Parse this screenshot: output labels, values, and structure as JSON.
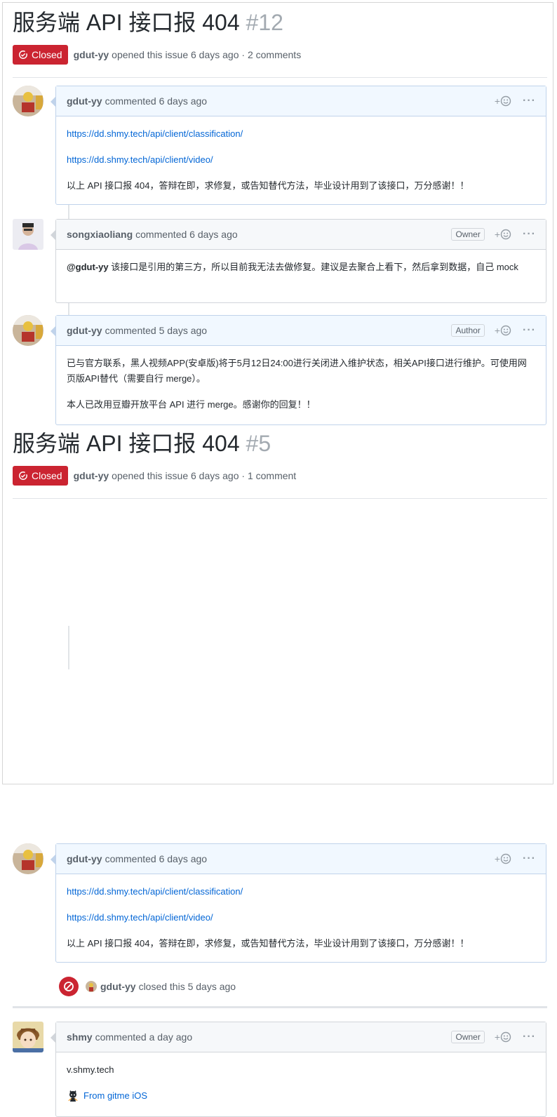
{
  "issues": [
    {
      "title": "服务端 API 接口报 404",
      "number": "#12",
      "state": "Closed",
      "opener": "gdut-yy",
      "opened_text": "opened this issue 6 days ago · 2 comments",
      "comments": [
        {
          "author": "gdut-yy",
          "time": "commented 6 days ago",
          "links": [
            "https://dd.shmy.tech/api/client/classification/",
            "https://dd.shmy.tech/api/client/video/"
          ],
          "text": "以上 API 接口报 404，答辩在即，求修复，或告知替代方法，毕业设计用到了该接口，万分感谢！！"
        },
        {
          "author": "songxiaoliang",
          "time": "commented 6 days ago",
          "role": "Owner",
          "mention": "@gdut-yy",
          "text": " 该接口是引用的第三方，所以目前我无法去做修复。建议是去聚合上看下，然后拿到数据，自己 mock"
        },
        {
          "author": "gdut-yy",
          "time": "commented 5 days ago",
          "role": "Author",
          "p1": "已与官方联系，黑人视频APP(安卓版)将于5月12日24:00进行关闭进入维护状态，相关API接口进行维护。可使用网页版API替代（需要自行 merge）。",
          "p2": "本人已改用豆瓣开放平台 API 进行 merge。感谢你的回复！！"
        }
      ]
    },
    {
      "title": "服务端 API 接口报 404",
      "number": "#5",
      "state": "Closed",
      "opener": "gdut-yy",
      "opened_text": "opened this issue 6 days ago · 1 comment",
      "comments": [
        {
          "author": "gdut-yy",
          "time": "commented 6 days ago",
          "links": [
            "https://dd.shmy.tech/api/client/classification/",
            "https://dd.shmy.tech/api/client/video/"
          ],
          "text": "以上 API 接口报 404，答辩在即，求修复，或告知替代方法，毕业设计用到了该接口，万分感谢！！"
        },
        {
          "author": "shmy",
          "time": "commented a day ago",
          "role": "Owner",
          "text": "v.shmy.tech",
          "source": "From gitme iOS"
        }
      ],
      "closed_event": {
        "actor": "gdut-yy",
        "text": "closed this 5 days ago"
      }
    }
  ],
  "reaction_plus": "+",
  "more_menu": "···",
  "colors": {
    "closed": "#cb2431",
    "link": "#0366d6",
    "header_bg": "#f1f8ff",
    "header_border": "#c0d3eb"
  },
  "icons": [
    "issue-closed-icon",
    "smiley-icon",
    "kebab-horizontal-icon",
    "circle-slash-icon",
    "octocat-icon"
  ]
}
